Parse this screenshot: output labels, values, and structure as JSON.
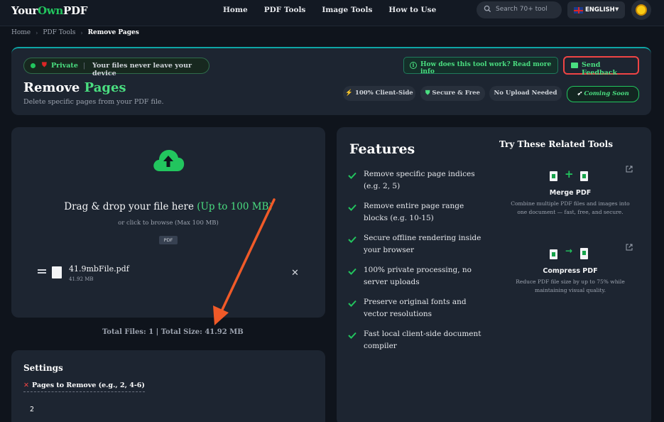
{
  "nav": {
    "logo_a": "Your",
    "logo_b": "Own",
    "logo_c": "PDF",
    "links": [
      "Home",
      "PDF Tools",
      "Image Tools",
      "How to Use"
    ],
    "search_placeholder": "Search 70+ tool",
    "language": "ENGLISH"
  },
  "breadcrumb": [
    "Home",
    "PDF Tools",
    "Remove Pages"
  ],
  "hero": {
    "private_label": "Private",
    "private_sep": "|",
    "private_text": "Your files never leave your device",
    "how_button": "How does this tool work? Read more info",
    "feedback_button": "Send Feedback",
    "title_a": "Remove ",
    "title_b": "Pages",
    "subtitle": "Delete specific pages from your PDF file.",
    "pills": [
      "100% Client-Side",
      "Secure & Free",
      "No Upload Needed",
      "Coming Soon"
    ]
  },
  "upload": {
    "drag_text": "Drag & drop your file here ",
    "drag_limit": "(Up to 100 MB)",
    "browse_text": "or click to browse (Max 100 MB)",
    "tag": "PDF",
    "file_name": "41.9mbFile.pdf",
    "file_size": "41.92 MB"
  },
  "totals": "Total Files: 1  |  Total Size: 41.92 MB",
  "settings": {
    "title": "Settings",
    "pages_label": "Pages to Remove (e.g., 2, 4-6)",
    "pages_value": "2"
  },
  "features": {
    "title": "Features",
    "items": [
      "Remove specific page indices (e.g. 2, 5)",
      "Remove entire page range blocks (e.g. 10-15)",
      "Secure offline rendering inside your browser",
      "100% private processing, no server uploads",
      "Preserve original fonts and vector resolutions",
      "Fast local client-side document compiler"
    ],
    "related_title": "Try These Related Tools",
    "tools": [
      {
        "name": "Merge PDF",
        "desc": "Combine multiple PDF files and images into one document — fast, free, and secure."
      },
      {
        "name": "Compress PDF",
        "desc": "Reduce PDF file size by up to 75% while maintaining visual quality."
      }
    ]
  },
  "colors": {
    "accent": "#22c55e",
    "annotation_arrow": "#f05a28",
    "danger": "#ef4444"
  }
}
